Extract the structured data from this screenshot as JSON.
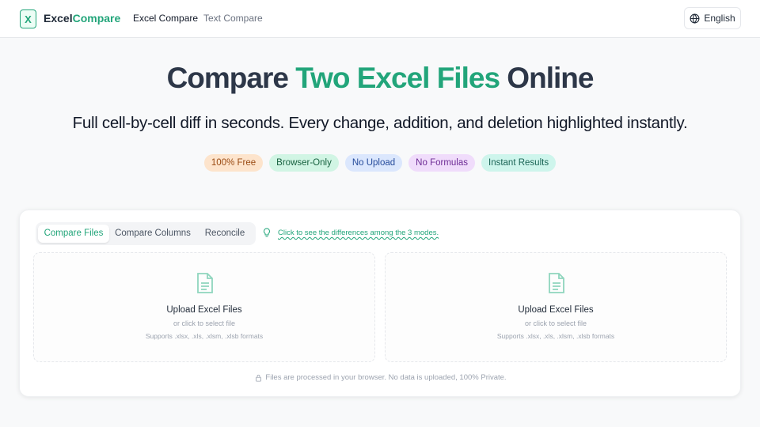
{
  "header": {
    "logo_letter": "X",
    "logo_text_1": "Excel",
    "logo_text_2": "Compare",
    "nav": [
      "Excel Compare",
      "Text Compare"
    ],
    "language": "English"
  },
  "hero": {
    "title_1": "Compare ",
    "title_accent": "Two Excel Files",
    "title_2": " Online",
    "subtitle": "Full cell-by-cell diff in seconds. Every change, addition, and deletion highlighted instantly.",
    "badges": [
      "100% Free",
      "Browser-Only",
      "No Upload",
      "No Formulas",
      "Instant Results"
    ]
  },
  "card": {
    "tabs": [
      "Compare Files",
      "Compare Columns",
      "Reconcile"
    ],
    "active_tab": "Compare Files",
    "hint": "Click to see the differences among the 3 modes.",
    "dropzones": [
      {
        "title": "Upload Excel Files",
        "subtitle": "or click to select file",
        "formats": "Supports .xlsx, .xls, .xlsm, .xlsb formats"
      },
      {
        "title": "Upload Excel Files",
        "subtitle": "or click to select file",
        "formats": "Supports .xlsx, .xls, .xlsm, .xlsb formats"
      }
    ],
    "privacy": "Files are processed in your browser. No data is uploaded, 100% Private."
  },
  "colors": {
    "accent": "#22a57a",
    "title": "#2d3748"
  },
  "icons": [
    "excel-logo-icon",
    "globe-icon",
    "lightbulb-icon",
    "document-icon",
    "lock-icon"
  ]
}
